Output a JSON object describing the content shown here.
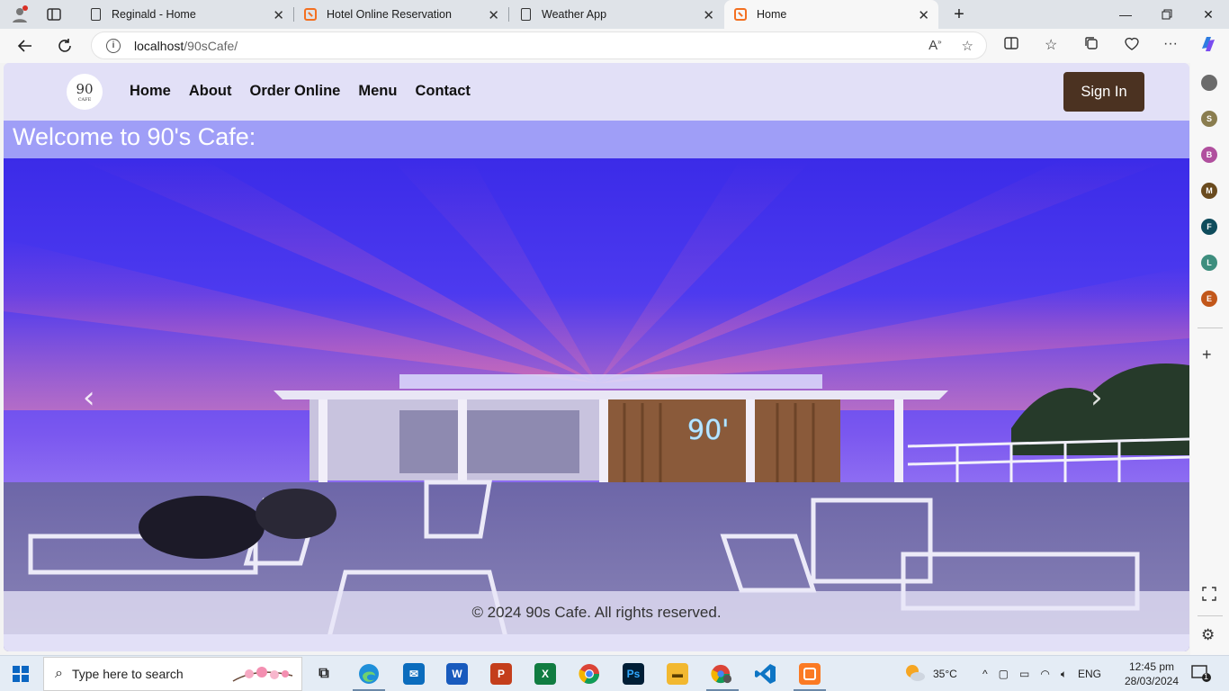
{
  "browser": {
    "tabs": [
      {
        "title": "Reginald - Home",
        "icon": "page-icon"
      },
      {
        "title": "Hotel Online Reservation",
        "icon": "xampp-icon"
      },
      {
        "title": "Weather App",
        "icon": "page-icon"
      },
      {
        "title": "Home",
        "icon": "xampp-icon",
        "active": true
      }
    ],
    "url_host": "localhost",
    "url_path": "/90sCafe/"
  },
  "site": {
    "logo_text": "90",
    "logo_sub": "CAFE",
    "nav": [
      "Home",
      "About",
      "Order Online",
      "Menu",
      "Contact"
    ],
    "signin_label": "Sign In",
    "welcome": "Welcome to 90's Cafe:",
    "footer": "© 2024 90s Cafe. All rights reserved.",
    "carousel_prev": "‹",
    "carousel_next": "›"
  },
  "edge_sidebar": {
    "profiles": [
      {
        "letter": "",
        "color": "#6b6b6b"
      },
      {
        "letter": "S",
        "color": "#8a7d4f"
      },
      {
        "letter": "B",
        "color": "#b04f9e"
      },
      {
        "letter": "M",
        "color": "#6a4b1f"
      },
      {
        "letter": "F",
        "color": "#0f4c5c"
      },
      {
        "letter": "L",
        "color": "#3e8e7e"
      },
      {
        "letter": "E",
        "color": "#c2571a"
      }
    ]
  },
  "taskbar": {
    "search_placeholder": "Type here to search",
    "weather": "35°C",
    "language": "ENG",
    "time": "12:45 pm",
    "date": "28/03/2024",
    "notification_count": "1"
  },
  "colors": {
    "nav_bg": "#e2e0f7",
    "welcome_bg": "#9f9ef7",
    "signin_bg": "#4b3221"
  }
}
